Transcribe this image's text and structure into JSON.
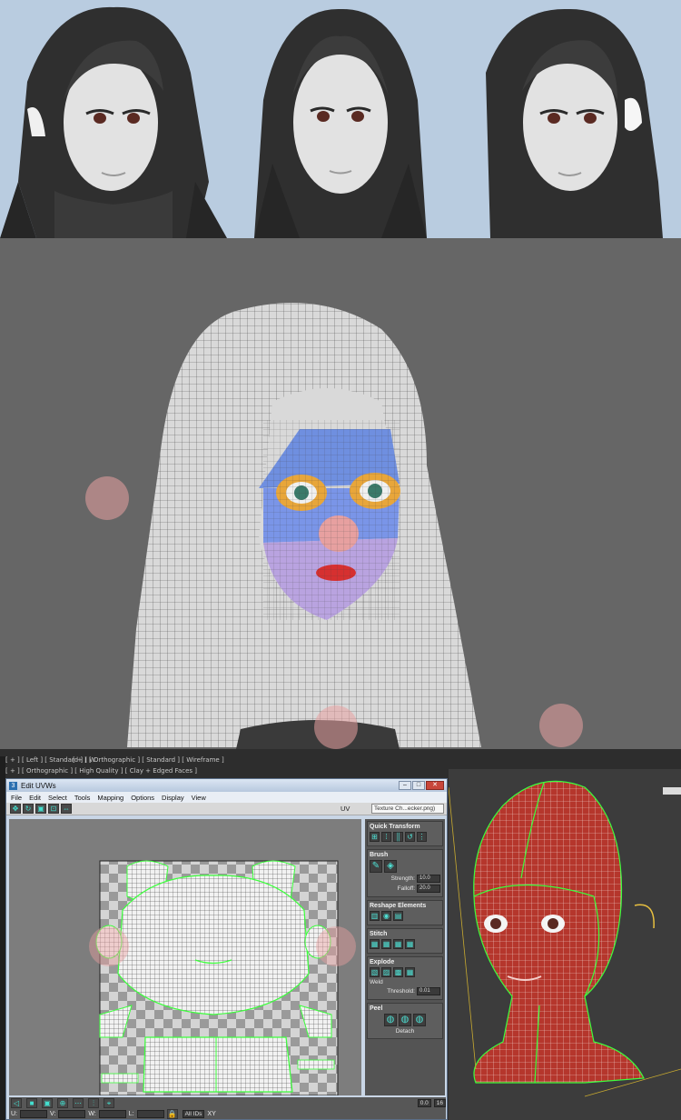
{
  "viewport_labels": {
    "top_left": "[ + ] [ Left ] [ Standard ] [ W",
    "top_mid": "[ + ] [ Orthographic ] [ Standard ] [ Wireframe ]",
    "second": "[ + ] [ Orthographic ] [ High Quality ] [ Clay + Edged Faces ]"
  },
  "uvw_window": {
    "title": "Edit UVWs",
    "app_icon": "3",
    "window_buttons": {
      "minimize": "–",
      "maximize": "□",
      "close": "✕"
    },
    "menu": [
      "File",
      "Edit",
      "Select",
      "Tools",
      "Mapping",
      "Options",
      "Display",
      "View"
    ],
    "toolbar": {
      "uv_label": "UV",
      "texture_dropdown": "Texture Ch...ecker.png)"
    },
    "rollouts": {
      "quick_transform": "Quick Transform",
      "brush": "Brush",
      "strength_label": "Strength:",
      "strength_value": "10.0",
      "falloff_label": "Falloff:",
      "falloff_value": "20.0",
      "reshape": "Reshape Elements",
      "stitch": "Stitch",
      "explode": "Explode",
      "weld": "Weld",
      "threshold_label": "Threshold:",
      "threshold_value": "0.01",
      "peel": "Peel",
      "detach": "Detach"
    },
    "bottom": {
      "u_label": "U:",
      "v_label": "V:",
      "w_label": "W:",
      "l_label": "L:",
      "xy_label": "XY",
      "zoom_value": "0.0",
      "grid_value": "16",
      "ids_dropdown": "All IDs"
    }
  },
  "colors": {
    "render_bg": "#b9cce0",
    "viewport_bg": "#666666",
    "accent_cyan": "#43e0d0",
    "seam_green": "#3cff3c",
    "head_red": "#b5362c"
  },
  "icons": {
    "move": "move-icon",
    "rotate": "rotate-icon",
    "freeform": "freeform-icon",
    "brush": "brush-icon",
    "pin": "pin-icon",
    "lock": "lock-icon"
  }
}
